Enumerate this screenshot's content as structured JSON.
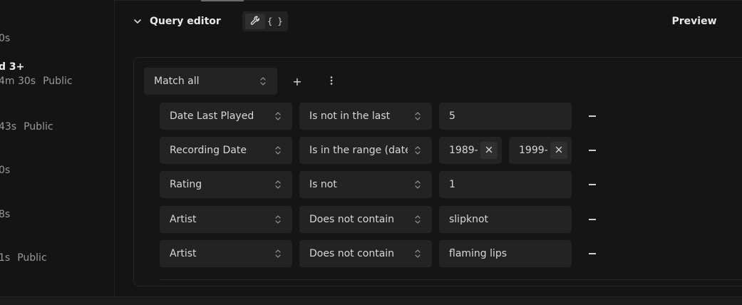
{
  "left_list": {
    "items": [
      {
        "title": "",
        "meta": "0s",
        "visibility": ""
      },
      {
        "title": "d 3+",
        "meta": "4m 30s",
        "visibility": "Public"
      },
      {
        "title": "",
        "meta": "43s",
        "visibility": "Public"
      },
      {
        "title": "",
        "meta": "0s",
        "visibility": ""
      },
      {
        "title": "",
        "meta": "8s",
        "visibility": ""
      },
      {
        "title": "",
        "meta": "1s",
        "visibility": "Public"
      }
    ]
  },
  "header": {
    "title": "Query editor",
    "mode_builder_icon": "wrench-icon",
    "mode_json_label": "{ }",
    "preview_label": "Preview"
  },
  "editor": {
    "match_select": "Match all",
    "add_label": "+",
    "more_icon": "kebab-icon",
    "rules": [
      {
        "field": "Date Last Played",
        "operator": "Is not in the last",
        "value": "5",
        "value2": ""
      },
      {
        "field": "Recording Date",
        "operator": "Is in the range (date)",
        "value": "1989-",
        "value2": "1999-"
      },
      {
        "field": "Rating",
        "operator": "Is not",
        "value": "1",
        "value2": ""
      },
      {
        "field": "Artist",
        "operator": "Does not contain",
        "value": "slipknot",
        "value2": ""
      },
      {
        "field": "Artist",
        "operator": "Does not contain",
        "value": "flaming lips",
        "value2": ""
      }
    ]
  },
  "colors": {
    "background": "#141414",
    "control": "#232323",
    "text": "#d8d8d8"
  }
}
